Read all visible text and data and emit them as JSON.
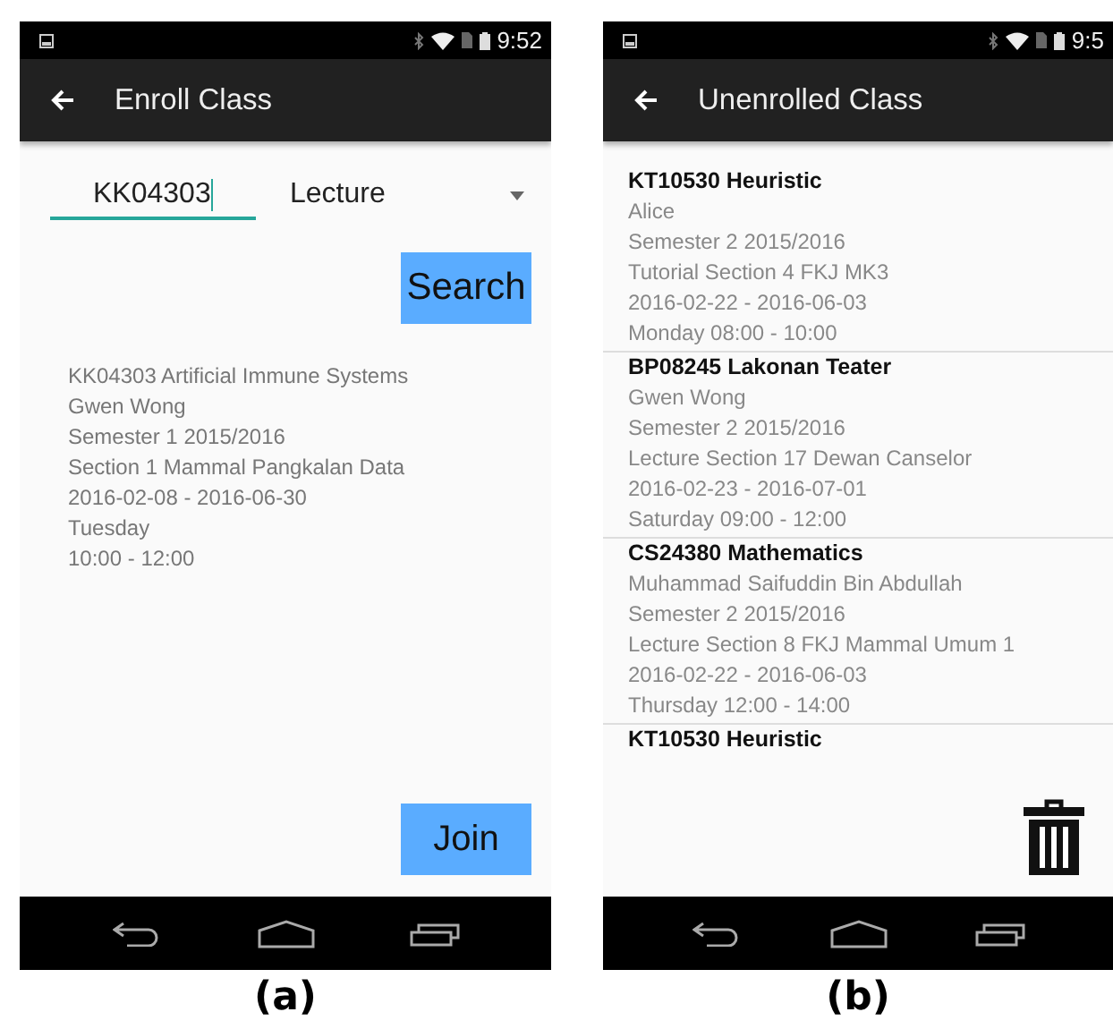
{
  "figures": [
    {
      "caption": "(a)",
      "screen": {
        "kind": "enroll",
        "status_bar": {
          "time": "9:52"
        },
        "app_bar": {
          "title": "Enroll Class"
        },
        "code_field": {
          "value": "KK04303"
        },
        "type_dropdown": {
          "value": "Lecture"
        },
        "search_button": "Search",
        "result": [
          "KK04303 Artificial Immune Systems",
          "Gwen Wong",
          "Semester 1 2015/2016",
          "Section 1 Mammal Pangkalan Data",
          "2016-02-08 - 2016-06-30",
          "Tuesday",
          "10:00 - 12:00"
        ],
        "join_button": "Join"
      }
    },
    {
      "caption": "(b)",
      "screen": {
        "kind": "list",
        "status_bar": {
          "time": "9:5"
        },
        "app_bar": {
          "title": "Unenrolled Class"
        },
        "classes": [
          {
            "title": "KT10530 Heuristic",
            "details": [
              "Alice",
              "Semester 2 2015/2016",
              "Tutorial Section 4 FKJ MK3",
              "2016-02-22 - 2016-06-03",
              "Monday 08:00 - 10:00"
            ]
          },
          {
            "title": "BP08245 Lakonan Teater",
            "details": [
              "Gwen Wong",
              "Semester 2 2015/2016",
              "Lecture Section 17 Dewan Canselor",
              "2016-02-23 - 2016-07-01",
              "Saturday 09:00 - 12:00"
            ]
          },
          {
            "title": "CS24380 Mathematics",
            "details": [
              "Muhammad Saifuddin Bin Abdullah",
              "Semester 2 2015/2016",
              "Lecture Section 8 FKJ Mammal Umum 1",
              "2016-02-22 - 2016-06-03",
              "Thursday 12:00 - 14:00"
            ]
          },
          {
            "title": "KT10530 Heuristic"
          }
        ]
      }
    }
  ]
}
